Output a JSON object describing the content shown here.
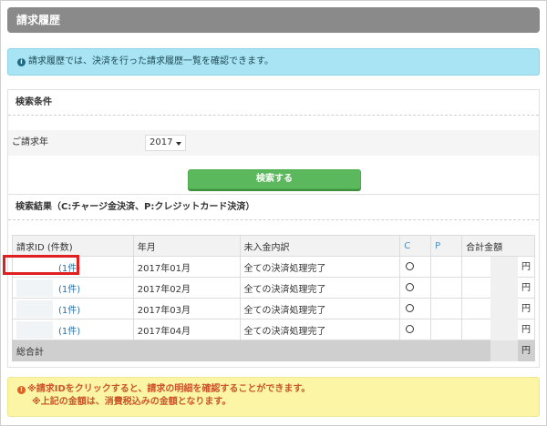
{
  "header": {
    "title": "請求履歴"
  },
  "info": {
    "icon": "info-icon",
    "text": "請求履歴では、決済を行った請求履歴一覧を確認できます。"
  },
  "conditions": {
    "title": "検索条件",
    "year_label": "ご請求年",
    "year_value": "2017",
    "search_button": "検索する"
  },
  "results": {
    "title": "検索結果（C:チャージ金決済、P:クレジットカード決済）",
    "columns": [
      "請求ID (件数)",
      "年月",
      "未入金内訳",
      "C",
      "P",
      "合計金額"
    ],
    "rows": [
      {
        "id_text": "(1件)",
        "month": "2017年01月",
        "status": "全ての決済処理完了",
        "c": "○",
        "p": "",
        "amount": "円"
      },
      {
        "id_text": "(1件)",
        "month": "2017年02月",
        "status": "全ての決済処理完了",
        "c": "○",
        "p": "",
        "amount": "円"
      },
      {
        "id_text": "(1件)",
        "month": "2017年03月",
        "status": "全ての決済処理完了",
        "c": "○",
        "p": "",
        "amount": "円"
      },
      {
        "id_text": "(1件)",
        "month": "2017年04月",
        "status": "全ての決済処理完了",
        "c": "○",
        "p": "",
        "amount": "円"
      }
    ],
    "total_label": "総合計",
    "total_amount": "円"
  },
  "notes": {
    "icon": "warning-icon",
    "line1": "※請求IDをクリックすると、請求の明細を確認することができます。",
    "line2": "※上記の金額は、消費税込みの金額となります。"
  },
  "colors": {
    "header_bg": "#8a8a8a",
    "info_bg": "#a8e4f3",
    "button_green": "#5cb85c",
    "note_bg": "#fdf5a6",
    "note_text": "#c9552a",
    "highlight_red": "#e02020"
  }
}
